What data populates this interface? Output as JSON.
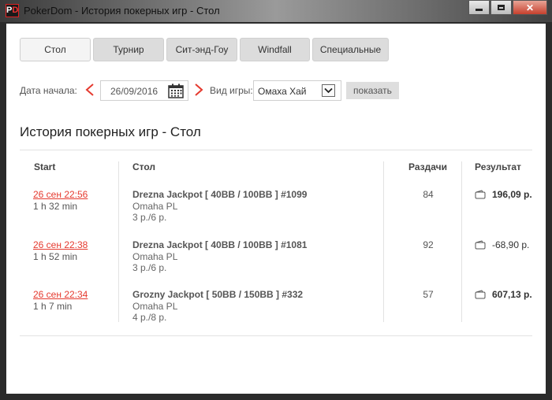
{
  "window": {
    "title": "PokerDom - История покерных игр - Стол",
    "logo_text": "PD"
  },
  "tabs": [
    {
      "label": "Стол",
      "active": true
    },
    {
      "label": "Турнир",
      "active": false
    },
    {
      "label": "Сит-энд-Гоу",
      "active": false
    },
    {
      "label": "Windfall",
      "active": false
    },
    {
      "label": "Специальные",
      "active": false
    }
  ],
  "filters": {
    "date_label": "Дата начала:",
    "date_value": "26/09/2016",
    "game_label": "Вид игры:",
    "game_value": "Омаха Хай",
    "show_label": "показать"
  },
  "page_title": "История покерных игр - Стол",
  "table": {
    "headers": {
      "start": "Start",
      "table": "Стол",
      "hands": "Раздачи",
      "result": "Результат"
    },
    "rows": [
      {
        "date": "26 сен 22:56",
        "duration": "1 h 32 min",
        "name": "Drezna Jackpot [ 40BB / 100BB ] #1099",
        "game": "Omaha PL",
        "players": "3 р./6 р.",
        "hands": "84",
        "result": "196,09 р."
      },
      {
        "date": "26 сен 22:38",
        "duration": "1 h 52 min",
        "name": "Drezna Jackpot [ 40BB / 100BB ] #1081",
        "game": "Omaha PL",
        "players": "3 р./6 р.",
        "hands": "92",
        "result": "-68,90 р."
      },
      {
        "date": "26 сен 22:34",
        "duration": "1 h 7 min",
        "name": "Grozny Jackpot [ 50BB / 150BB ] #332",
        "game": "Omaha PL",
        "players": "4 р./8 р.",
        "hands": "57",
        "result": "607,13 р."
      }
    ]
  },
  "colors": {
    "accent": "#e53a2f",
    "tab_bg": "#dcdcdc",
    "tab_active_bg": "#f4f4f4"
  },
  "icons": {
    "prev": "chevron-left-icon",
    "next": "chevron-right-icon",
    "calendar": "calendar-icon",
    "dropdown": "chevron-down-icon",
    "wallet": "wallet-icon"
  }
}
